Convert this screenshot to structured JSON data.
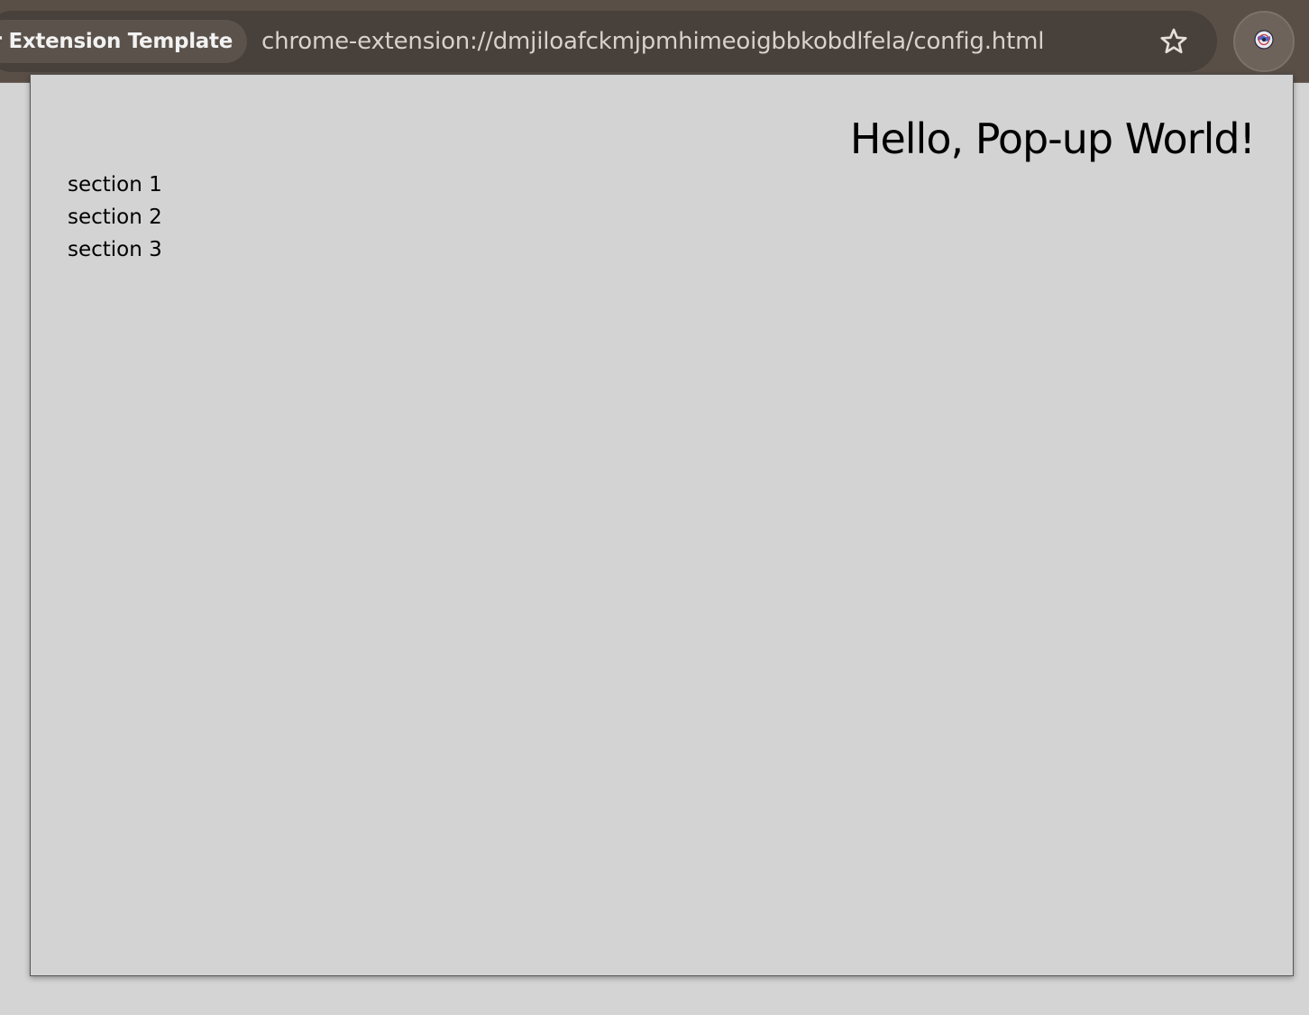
{
  "browser": {
    "tab_title": "ser Extension Template",
    "url": "chrome-extension://dmjiloafckmjpmhimeoigbbkobdlfela/config.html",
    "star_icon": "bookmark-star-icon",
    "extension_icon": "extension-globe-icon"
  },
  "popup": {
    "title": "Hello, Pop-up World!",
    "sections": [
      {
        "label": "section 1"
      },
      {
        "label": "section 2"
      },
      {
        "label": "section 3"
      }
    ]
  },
  "colors": {
    "toolbar": "#5a4f47",
    "omnibox": "#47403b",
    "popup_background": "#d3d3d3",
    "page_background": "#d4d4d4"
  }
}
